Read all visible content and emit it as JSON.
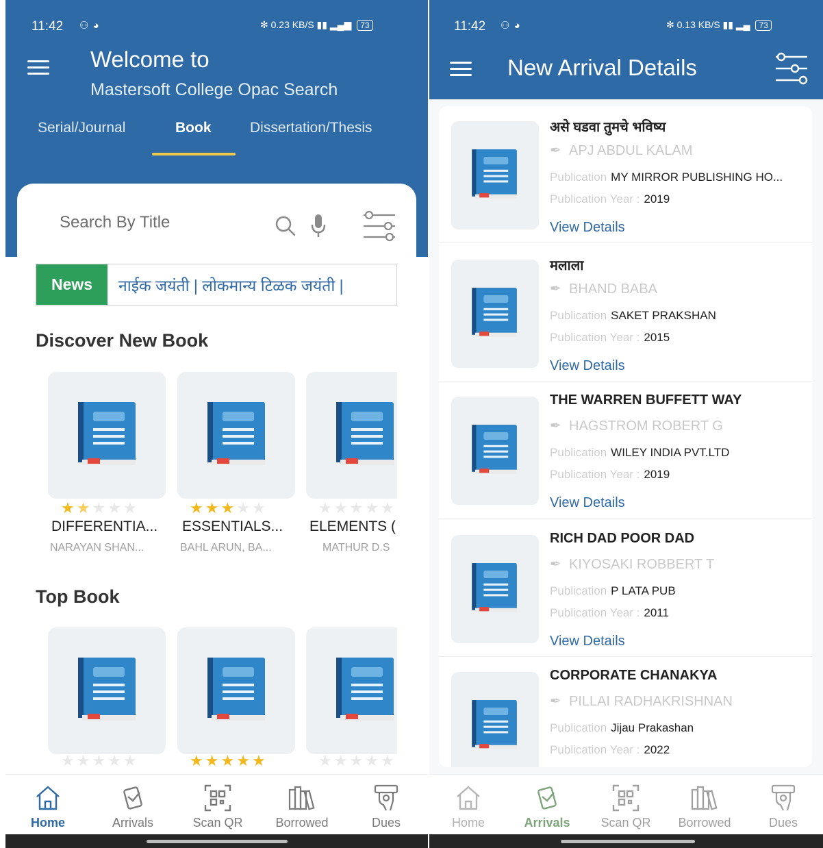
{
  "status": {
    "time": "11:42",
    "left_speed": "0.23",
    "right_speed": "0.13",
    "speed_unit": "KB/S",
    "battery": "73"
  },
  "home": {
    "welcome": "Welcome to",
    "subtitle": "Mastersoft College Opac Search",
    "tabs": [
      {
        "label": "Serial/Journal"
      },
      {
        "label": "Book"
      },
      {
        "label": "Dissertation/Thesis"
      }
    ],
    "search_placeholder": "Search By Title",
    "news_label": "News",
    "news_text": "नाईक जयंती | लोकमान्य टिळक जयंती |",
    "discover_title": "Discover New Book",
    "top_title": "Top Book",
    "discover_books": [
      {
        "title": "DIFFERENTIA...",
        "author": "NARAYAN SHAN...",
        "rating": 1.5
      },
      {
        "title": "ESSENTIALS...",
        "author": "BAHL ARUN, BA...",
        "rating": 3
      },
      {
        "title": "ELEMENTS (",
        "author": "MATHUR D.S",
        "rating": 0
      }
    ],
    "top_books": [
      {
        "rating": 0
      },
      {
        "rating": 5
      },
      {
        "rating": 0
      }
    ]
  },
  "arrivals": {
    "title": "New Arrival Details",
    "pub_label": "Publication",
    "year_label": "Publication Year :",
    "link_label": "View Details",
    "items": [
      {
        "title": "असे घडवा तुमचे भविष्य",
        "author": "APJ ABDUL KALAM",
        "publication": "MY MIRROR PUBLISHING HO...",
        "year": "2019"
      },
      {
        "title": "मलाला",
        "author": "BHAND BABA",
        "publication": "SAKET PRAKSHAN",
        "year": "2015"
      },
      {
        "title": "THE WARREN BUFFETT WAY",
        "author": "HAGSTROM ROBERT G",
        "publication": "WILEY INDIA PVT.LTD",
        "year": "2019"
      },
      {
        "title": "RICH DAD POOR DAD",
        "author": "KIYOSAKI ROBBERT T",
        "publication": "P LATA PUB",
        "year": "2011"
      },
      {
        "title": "CORPORATE CHANAKYA",
        "author": "PILLAI RADHAKRISHNAN",
        "publication": "Jijau Prakashan",
        "year": "2022"
      }
    ]
  },
  "nav": {
    "items": [
      {
        "label": "Home",
        "icon": "home-icon"
      },
      {
        "label": "Arrivals",
        "icon": "arrivals-icon"
      },
      {
        "label": "Scan QR",
        "icon": "qr-scan-icon"
      },
      {
        "label": "Borrowed",
        "icon": "books-icon"
      },
      {
        "label": "Dues",
        "icon": "dues-icon"
      }
    ]
  },
  "colors": {
    "primary": "#2e6aa6",
    "news_green": "#2e9e5b",
    "tab_indicator": "#f2c94c",
    "star": "#f2b81d"
  }
}
